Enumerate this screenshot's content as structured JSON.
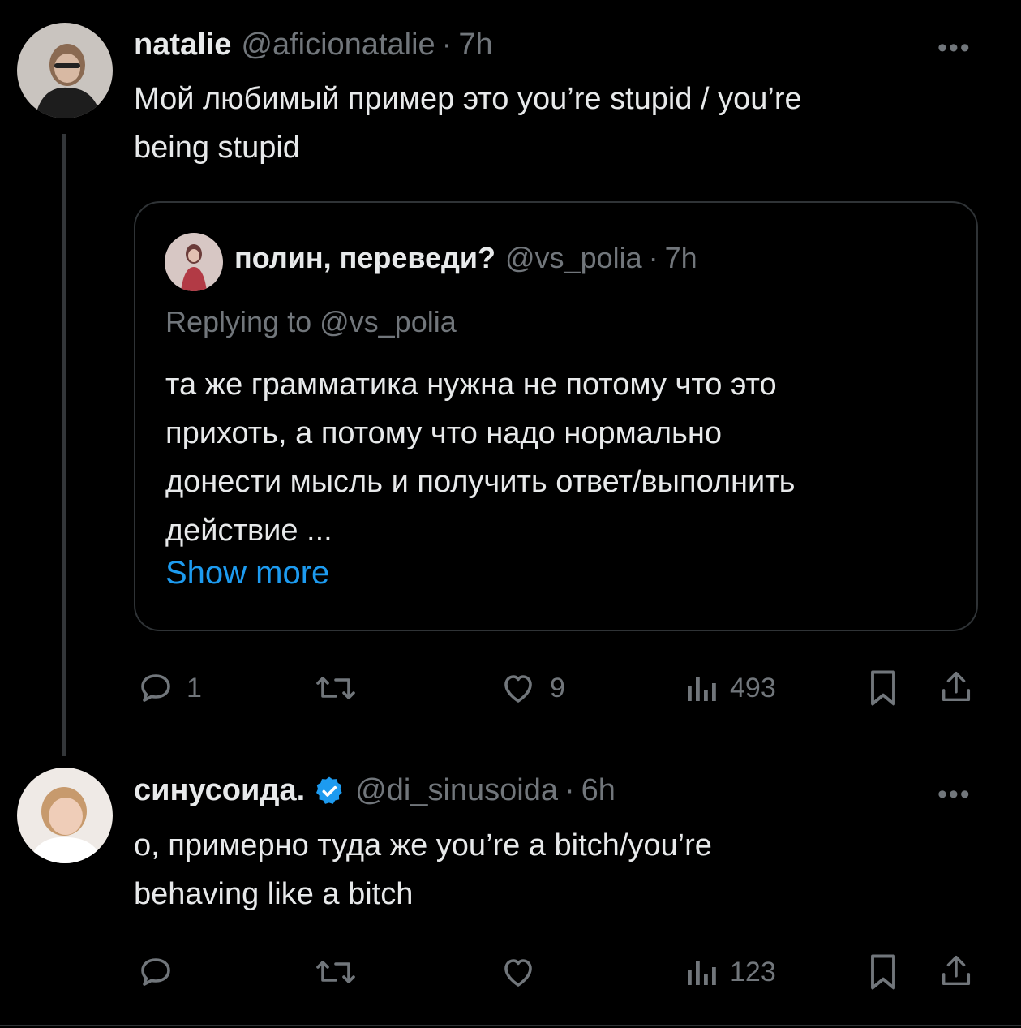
{
  "tweet1": {
    "name": "natalie",
    "handle": "@aficionatalie",
    "sep": "·",
    "time": "7h",
    "more": "•••",
    "text_line1": "Мой любимый пример это you’re stupid / you’re",
    "text_line2": "being stupid",
    "quote": {
      "name": "полин, переведи?",
      "handle": "@vs_polia",
      "sep": "·",
      "time": "7h",
      "replying_to": "Replying to @vs_polia",
      "text_line1": "та же грамматика нужна не потому что это",
      "text_line2": "прихоть, а потому что надо нормально",
      "text_line3": "донести мысль и получить ответ/выполнить",
      "text_line4": "действие ...",
      "show_more": "Show more"
    },
    "actions": {
      "reply_count": "1",
      "like_count": "9",
      "views_count": "493"
    }
  },
  "tweet2": {
    "name": "синусоида.",
    "handle": "@di_sinusoida",
    "sep": "·",
    "time": "6h",
    "more": "•••",
    "verified": true,
    "text_line1": "о, примерно туда же you’re a bitch/you’re",
    "text_line2": "behaving like a bitch",
    "actions": {
      "views_count": "123"
    }
  },
  "colors": {
    "background": "#000000",
    "text": "#e7e9ea",
    "muted": "#71767b",
    "link": "#1d9bf0",
    "border": "#2f3336"
  },
  "icons": [
    "reply-icon",
    "retweet-icon",
    "like-icon",
    "views-icon",
    "bookmark-icon",
    "share-icon",
    "verified-badge-icon",
    "more-icon"
  ]
}
